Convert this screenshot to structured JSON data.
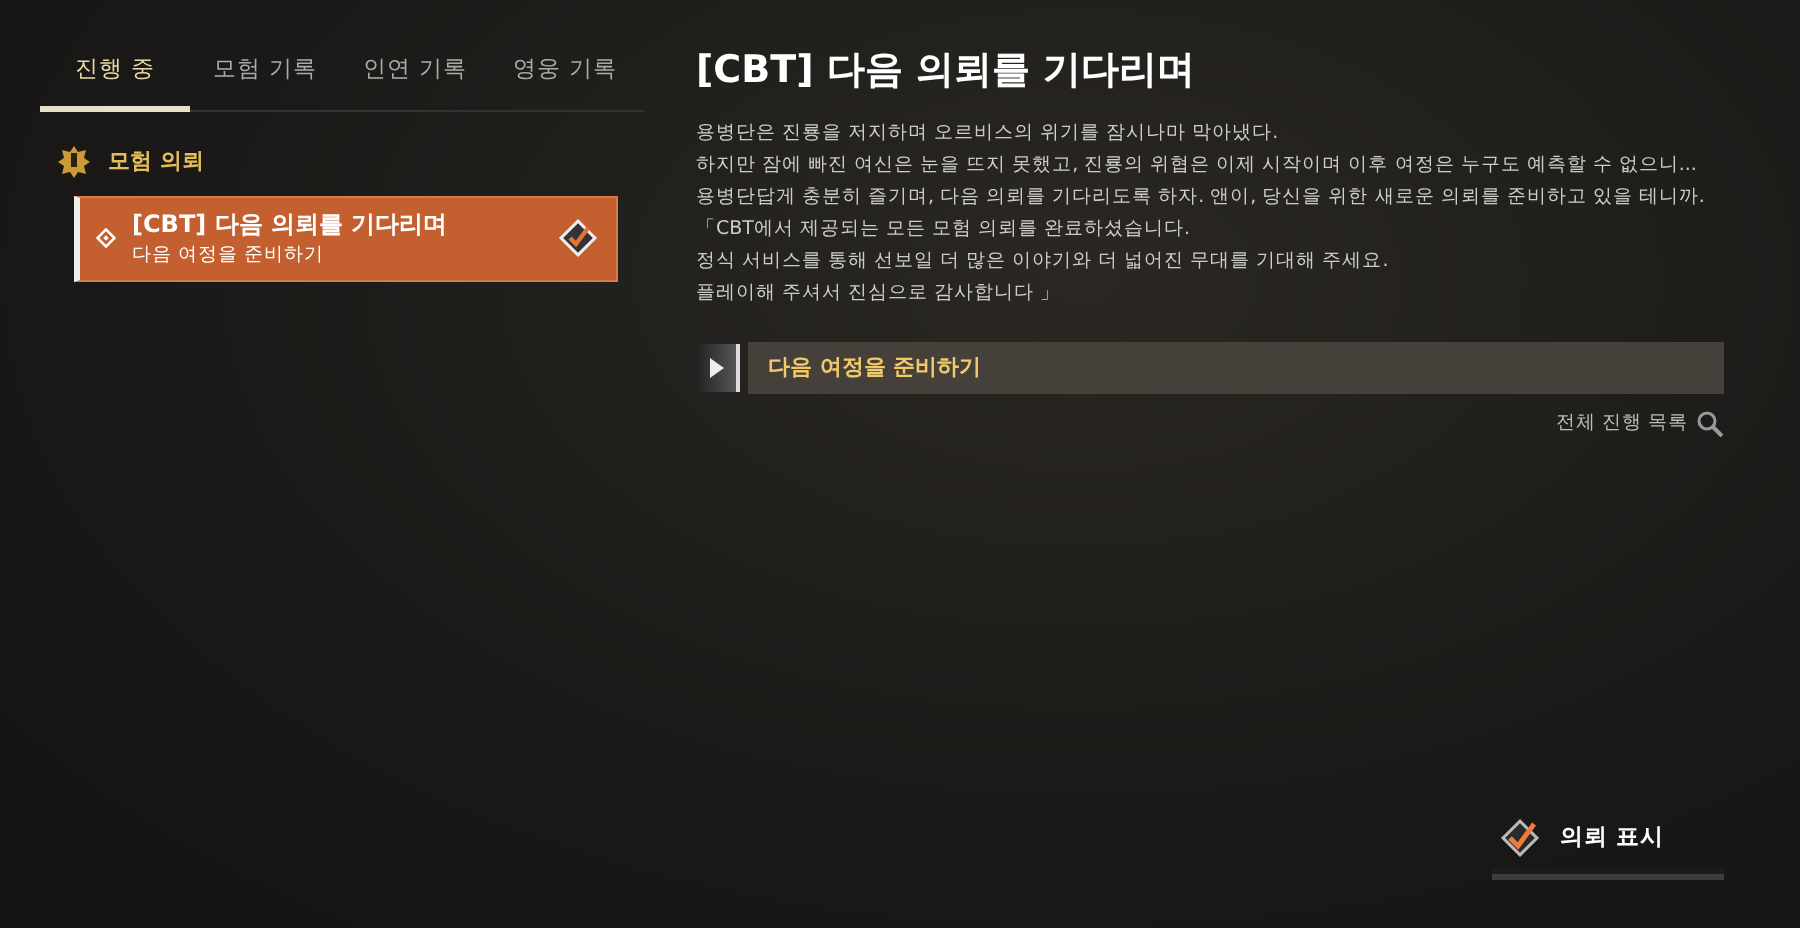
{
  "tabs": [
    {
      "label": "진행 중",
      "selected": true
    },
    {
      "label": "모험 기록",
      "selected": false
    },
    {
      "label": "인연 기록",
      "selected": false
    },
    {
      "label": "영웅 기록",
      "selected": false
    }
  ],
  "category": {
    "label": "모험 의뢰"
  },
  "quests": [
    {
      "title": "[CBT] 다음 의뢰를 기다리며",
      "subtitle": "다음 여정을 준비하기",
      "selected": true,
      "tracked": true
    }
  ],
  "detail": {
    "title": "[CBT] 다음 의뢰를 기다리며",
    "lines": [
      "용병단은 진룡을 저지하며 오르비스의 위기를 잠시나마 막아냈다.",
      "하지만 잠에 빠진 여신은 눈을 뜨지 못했고, 진룡의 위협은 이제 시작이며 이후 여정은 누구도 예측할 수 없으니...",
      "용병단답게 충분히 즐기며, 다음 의뢰를 기다리도록 하자. 앤이, 당신을 위한 새로운 의뢰를 준비하고 있을 테니까.",
      "「CBT에서 제공되는 모든 모험 의뢰를 완료하셨습니다.",
      "정식 서비스를 통해 선보일 더 많은 이야기와 더 넓어진 무대를 기대해 주세요.",
      "플레이해 주셔서 진심으로 감사합니다 」"
    ],
    "objective": "다음 여정을 준비하기",
    "progress_link": "전체 진행 목록"
  },
  "track_button": {
    "label": "의뢰 표시",
    "checked": true
  }
}
